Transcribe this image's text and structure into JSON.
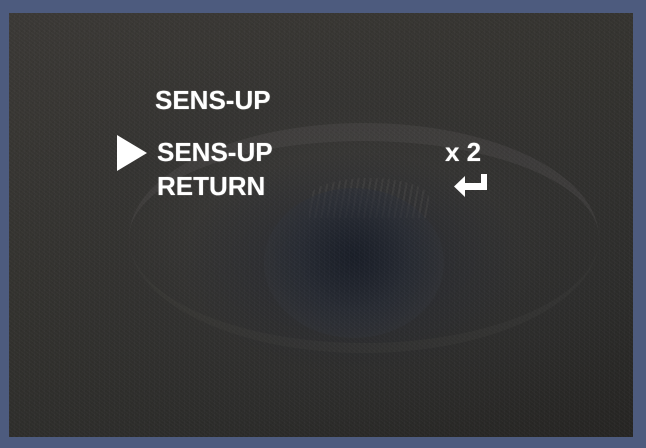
{
  "menu": {
    "title": "SENS-UP",
    "items": [
      {
        "label": "SENS-UP",
        "value": "x 2",
        "selected": true
      },
      {
        "label": "RETURN",
        "icon": "enter-return-icon",
        "selected": false
      }
    ],
    "cursor_icon": "selection-triangle-icon"
  },
  "colors": {
    "frame": "#4d5b7e",
    "osd_text": "#ffffff"
  }
}
